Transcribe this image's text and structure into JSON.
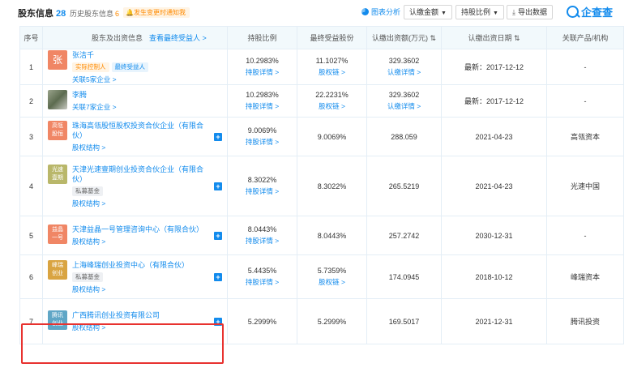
{
  "header": {
    "title": "股东信息",
    "count": "28",
    "history_label": "历史股东信息",
    "history_count": "6",
    "notice": "发生变更时通知我",
    "chart_analysis": "图表分析",
    "subscribe_amount": "认缴金额",
    "shareholding_ratio": "持股比例",
    "export": "导出数据",
    "brand": "企查查"
  },
  "columns": {
    "index": "序号",
    "holder": "股东及出资信息",
    "holder_link": "查看最终受益人 >",
    "ratio": "持股比例",
    "final_benefit": "最终受益股份",
    "subscribed": "认缴出资额(万元)",
    "date": "认缴出资日期",
    "related": "关联产品/机构"
  },
  "rows": [
    {
      "index": "1",
      "avatar": "张",
      "avatar_color": "#f08665",
      "avatar_type": "big",
      "name": "张洁千",
      "tags": [
        {
          "text": "实际控制人",
          "style": "o"
        },
        {
          "text": "最终受益人",
          "style": "b"
        }
      ],
      "sub": "关联5家企业 >",
      "sub_color": "orange",
      "ratio": "10.2983%",
      "ratio_link": "持股详情 >",
      "benefit": "11.1027%",
      "benefit_link": "股权链 >",
      "amount": "329.3602",
      "amount_link": "认缴详情 >",
      "date": "最新：2017-12-12",
      "related": "-",
      "plus": false
    },
    {
      "index": "2",
      "avatar": "",
      "avatar_color": "photo",
      "avatar_type": "photo",
      "name": "李腾",
      "tags": [],
      "sub": "关联7家企业 >",
      "sub_color": "orange",
      "ratio": "10.2983%",
      "ratio_link": "持股详情 >",
      "benefit": "22.2231%",
      "benefit_link": "股权链 >",
      "amount": "329.3602",
      "amount_link": "认缴详情 >",
      "date": "最新：2017-12-12",
      "related": "-",
      "plus": false
    },
    {
      "index": "3",
      "avatar": "高瓴股恒",
      "avatar_color": "#f08665",
      "avatar_type": "small",
      "name": "珠海高瓴股恒股权投资合伙企业（有限合伙）",
      "tags": [],
      "sub": "股权结构 >",
      "sub_color": "orange",
      "ratio": "9.0069%",
      "ratio_link": "持股详情 >",
      "benefit": "9.0069%",
      "benefit_link": "",
      "amount": "288.059",
      "amount_link": "",
      "date": "2021-04-23",
      "related": "高瓴资本",
      "plus": true
    },
    {
      "index": "4",
      "avatar": "光速壹期",
      "avatar_color": "#b9b76a",
      "avatar_type": "small",
      "name": "天津光速壹期创业投资合伙企业（有限合伙）",
      "tags": [
        {
          "text": "私募基金",
          "style": "g"
        }
      ],
      "sub": "股权结构 >",
      "sub_color": "orange",
      "ratio": "8.3022%",
      "ratio_link": "持股详情 >",
      "benefit": "8.3022%",
      "benefit_link": "",
      "amount": "265.5219",
      "amount_link": "",
      "date": "2021-04-23",
      "related": "光速中国",
      "plus": true
    },
    {
      "index": "5",
      "avatar": "益晶一号",
      "avatar_color": "#f08665",
      "avatar_type": "small",
      "name": "天津益晶一号管理咨询中心（有限合伙）",
      "tags": [],
      "sub": "股权结构 >",
      "sub_color": "orange",
      "ratio": "8.0443%",
      "ratio_link": "持股详情 >",
      "benefit": "8.0443%",
      "benefit_link": "",
      "amount": "257.2742",
      "amount_link": "",
      "date": "2030-12-31",
      "related": "-",
      "plus": true
    },
    {
      "index": "6",
      "avatar": "峰瑞创业",
      "avatar_color": "#d9a441",
      "avatar_type": "small",
      "name": "上海峰瑞创业投资中心（有限合伙）",
      "tags": [
        {
          "text": "私募基金",
          "style": "g"
        }
      ],
      "sub": "股权结构 >",
      "sub_color": "orange",
      "ratio": "5.4435%",
      "ratio_link": "持股详情 >",
      "benefit": "5.7359%",
      "benefit_link": "股权链 >",
      "amount": "174.0945",
      "amount_link": "",
      "date": "2018-10-12",
      "related": "峰瑞资本",
      "plus": true
    },
    {
      "index": "7",
      "avatar": "腾讯创业",
      "avatar_color": "#5fa6c6",
      "avatar_type": "small",
      "name": "广西腾讯创业投资有限公司",
      "tags": [],
      "sub": "股权结构 >",
      "sub_color": "orange",
      "ratio": "5.2999%",
      "ratio_link": "",
      "benefit": "5.2999%",
      "benefit_link": "",
      "amount": "169.5017",
      "amount_link": "",
      "date": "2021-12-31",
      "related": "腾讯投资",
      "plus": true
    }
  ],
  "row_heights": [
    44,
    40,
    48,
    74,
    48,
    54,
    56
  ]
}
